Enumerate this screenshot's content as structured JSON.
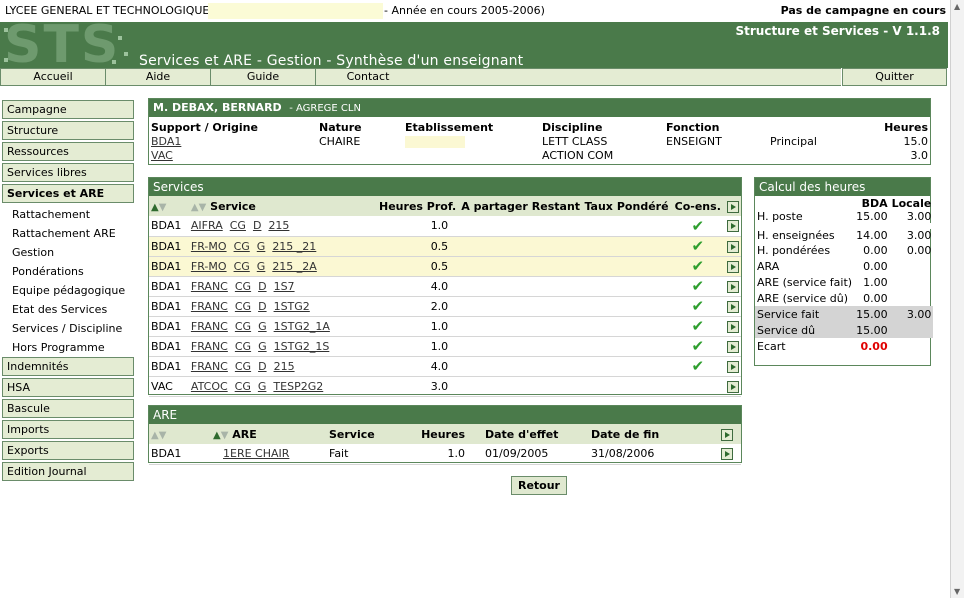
{
  "topbar": {
    "school": "LYCEE GENERAL ET TECHNOLOGIQUE",
    "year": "- Année en cours 2005-2006)",
    "campaign": "Pas de campagne en cours"
  },
  "header": {
    "logo": "STS",
    "version": "Structure et Services - V 1.1.8",
    "title": "Services et ARE - Gestion - Synthèse d'un enseignant"
  },
  "topnav": [
    "Accueil",
    "Aide",
    "Guide",
    "Contact",
    "Quitter"
  ],
  "sidebar": {
    "menu_top": [
      "Campagne",
      "Structure",
      "Ressources",
      "Services libres",
      "Services et ARE"
    ],
    "submenu": [
      "Rattachement",
      "Rattachement ARE",
      "Gestion",
      "Pondérations",
      "Equipe pédagogique",
      "Etat des Services",
      "Services / Discipline",
      "Hors Programme"
    ],
    "menu_bottom": [
      "Indemnités",
      "HSA",
      "Bascule",
      "Imports",
      "Exports",
      "Edition Journal"
    ]
  },
  "teacher": {
    "name": "M. DEBAX, BERNARD",
    "grade": "- AGREGE CLN",
    "headers": [
      "Support / Origine",
      "Nature",
      "Etablissement",
      "Discipline",
      "Fonction",
      "",
      "Heures"
    ],
    "rows": [
      [
        "BDA1",
        "CHAIRE",
        "",
        "LETT CLASS",
        "ENSEIGNT",
        "Principal",
        "15.0"
      ],
      [
        "VAC",
        "",
        "",
        "ACTION COM",
        "",
        "",
        "3.0"
      ]
    ]
  },
  "services": {
    "title": "Services",
    "headers": [
      "Service",
      "Heures Prof.",
      "A partager",
      "Restant",
      "Taux",
      "Pondéré",
      "Co-ens."
    ],
    "rows": [
      {
        "origin": "BDA1",
        "code": "AIFRA",
        "m": "CG",
        "t": "D",
        "div": "215",
        "hours": "1.0",
        "co": true,
        "hl": false
      },
      {
        "origin": "BDA1",
        "code": "FR-MO",
        "m": "CG",
        "t": "G",
        "div": "215 _21",
        "hours": "0.5",
        "co": true,
        "hl": true
      },
      {
        "origin": "BDA1",
        "code": "FR-MO",
        "m": "CG",
        "t": "G",
        "div": "215 _2A",
        "hours": "0.5",
        "co": true,
        "hl": true
      },
      {
        "origin": "BDA1",
        "code": "FRANC",
        "m": "CG",
        "t": "D",
        "div": "1S7",
        "hours": "4.0",
        "co": true,
        "hl": false
      },
      {
        "origin": "BDA1",
        "code": "FRANC",
        "m": "CG",
        "t": "D",
        "div": "1STG2",
        "hours": "2.0",
        "co": true,
        "hl": false
      },
      {
        "origin": "BDA1",
        "code": "FRANC",
        "m": "CG",
        "t": "G",
        "div": "1STG2_1A",
        "hours": "1.0",
        "co": true,
        "hl": false
      },
      {
        "origin": "BDA1",
        "code": "FRANC",
        "m": "CG",
        "t": "G",
        "div": "1STG2_1S",
        "hours": "1.0",
        "co": true,
        "hl": false
      },
      {
        "origin": "BDA1",
        "code": "FRANC",
        "m": "CG",
        "t": "D",
        "div": "215",
        "hours": "4.0",
        "co": true,
        "hl": false
      },
      {
        "origin": "VAC",
        "code": "ATCOC",
        "m": "CG",
        "t": "G",
        "div": "TESP2G2",
        "hours": "3.0",
        "co": false,
        "hl": false
      }
    ]
  },
  "are": {
    "title": "ARE",
    "headers": [
      "ARE",
      "Service",
      "Heures",
      "Date d'effet",
      "Date de fin"
    ],
    "rows": [
      {
        "origin": "BDA1",
        "are": "1ERE CHAIR",
        "service": "Fait",
        "hours": "1.0",
        "start": "01/09/2005",
        "end": "31/08/2006"
      }
    ]
  },
  "calc": {
    "title": "Calcul des heures",
    "col1": "BDA",
    "col2": "Locale",
    "rows": [
      {
        "label": "H. poste",
        "bda": "15.00",
        "loc": "3.00",
        "g": false,
        "red": false
      },
      {
        "label": "H. enseignées",
        "bda": "14.00",
        "loc": "3.00",
        "g": false,
        "red": false
      },
      {
        "label": "H. pondérées",
        "bda": "0.00",
        "loc": "0.00",
        "g": false,
        "red": false
      },
      {
        "label": "ARA",
        "bda": "0.00",
        "loc": "",
        "g": false,
        "red": false
      },
      {
        "label": "ARE (service fait)",
        "bda": "1.00",
        "loc": "",
        "g": false,
        "red": false
      },
      {
        "label": "ARE (service dû)",
        "bda": "0.00",
        "loc": "",
        "g": false,
        "red": false
      },
      {
        "label": "Service fait",
        "bda": "15.00",
        "loc": "3.00",
        "g": true,
        "red": false
      },
      {
        "label": "Service dû",
        "bda": "15.00",
        "loc": "",
        "g": true,
        "red": false
      },
      {
        "label": "Ecart",
        "bda": "0.00",
        "loc": "",
        "g": false,
        "red": true
      }
    ]
  },
  "buttons": {
    "retour": "Retour"
  },
  "icons": {
    "check": "check-icon",
    "go": "go-arrow-icon",
    "sort": "sort-arrows-icon"
  },
  "colors": {
    "header_green": "#4a7a4a",
    "menu_bg": "#e4ecd3",
    "highlight_row": "#fbf8d3",
    "check_green": "#2e9e2e",
    "ecart_red": "#e00000"
  }
}
